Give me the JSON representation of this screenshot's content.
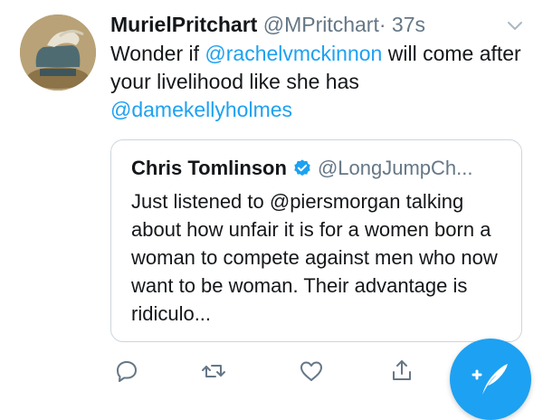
{
  "tweet": {
    "display_name": "MurielPritchart",
    "handle": "@MPritchart",
    "separator": "·",
    "time": "37s",
    "text_prefix": "Wonder if ",
    "mention_1": "@rachelvmckinnon",
    "text_middle": " will come after your livelihood like she has ",
    "mention_2": "@damekellyholmes"
  },
  "quoted_tweet": {
    "display_name": "Chris Tomlinson",
    "handle": "@LongJumpCh...",
    "verified": true,
    "text": "Just listened to @piersmorgan talking about how unfair it is for a women born a woman to compete against men who now want to be woman. Their advantage is ridiculo..."
  },
  "actions": [
    "reply-icon",
    "retweet-icon",
    "like-icon",
    "share-icon"
  ],
  "fab": {
    "icon": "compose-tweet-icon"
  },
  "colors": {
    "accent": "#1da1f2",
    "secondary_text": "#657786",
    "border": "#ccd6dd"
  }
}
